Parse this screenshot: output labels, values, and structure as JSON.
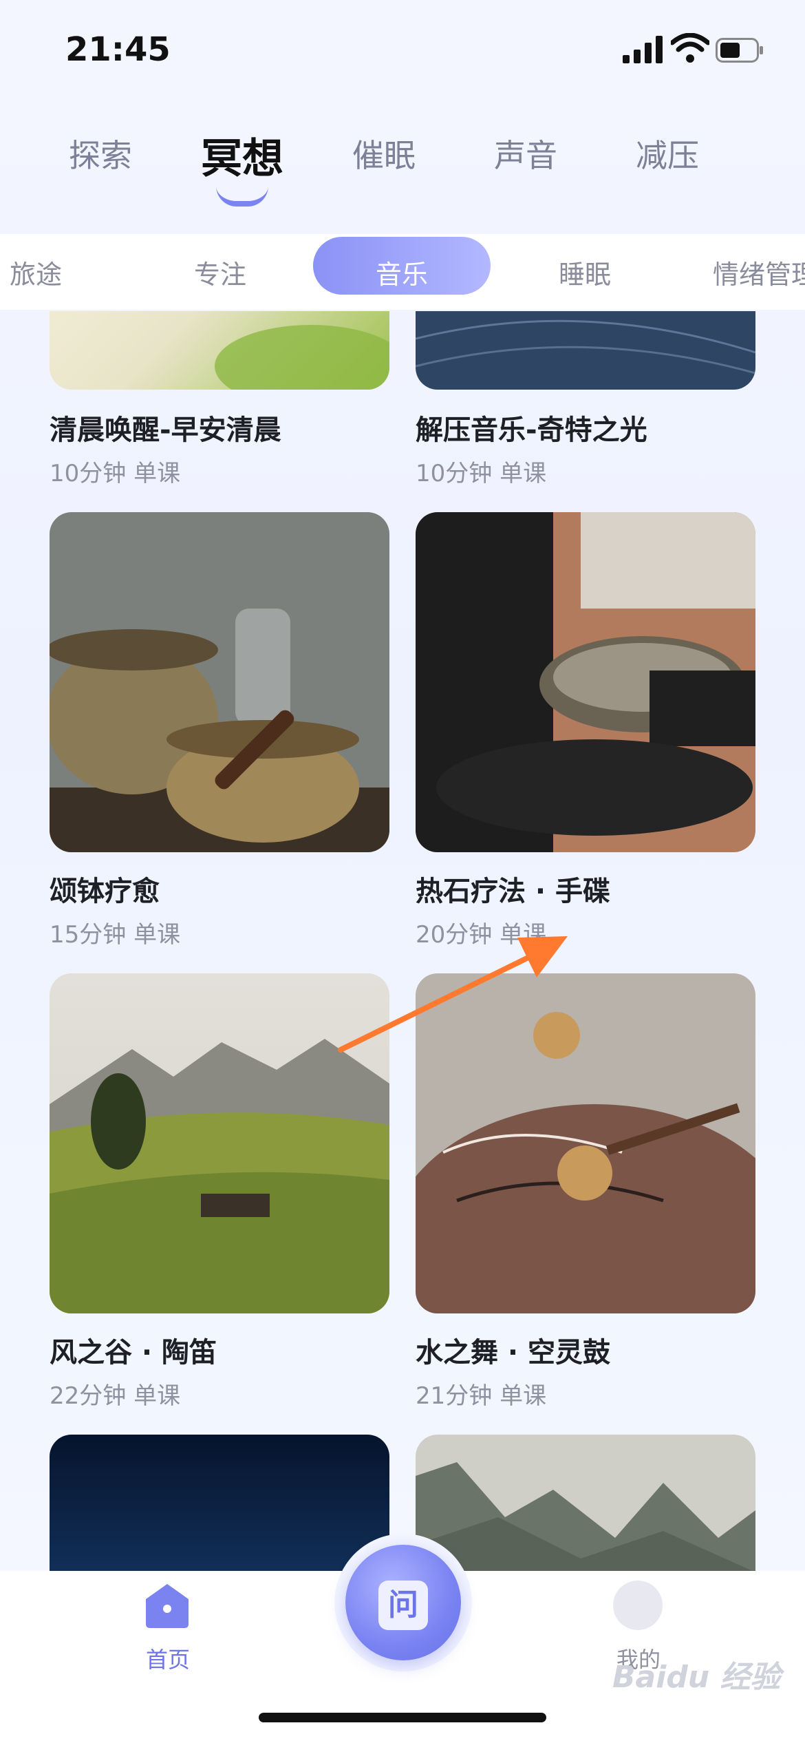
{
  "status_bar": {
    "time": "21:45"
  },
  "top_tabs": [
    {
      "label": "探索",
      "active": false
    },
    {
      "label": "冥想",
      "active": true
    },
    {
      "label": "催眠",
      "active": false
    },
    {
      "label": "声音",
      "active": false
    },
    {
      "label": "减压",
      "active": false
    }
  ],
  "sub_tabs": [
    {
      "label": "旅途",
      "active": false
    },
    {
      "label": "专注",
      "active": false
    },
    {
      "label": "音乐",
      "active": true
    },
    {
      "label": "睡眠",
      "active": false
    },
    {
      "label": "情绪管理",
      "active": false
    }
  ],
  "cards": [
    {
      "title": "清晨唤醒-早安清晨",
      "duration": "10分钟",
      "type": "单课"
    },
    {
      "title": "解压音乐-奇特之光",
      "duration": "10分钟",
      "type": "单课"
    },
    {
      "title": "颂钵疗愈",
      "duration": "15分钟",
      "type": "单课"
    },
    {
      "title": "热石疗法 · 手碟",
      "duration": "20分钟",
      "type": "单课"
    },
    {
      "title": "风之谷 · 陶笛",
      "duration": "22分钟",
      "type": "单课"
    },
    {
      "title": "水之舞 · 空灵鼓",
      "duration": "21分钟",
      "type": "单课"
    },
    {
      "title": "",
      "duration": "",
      "type": ""
    },
    {
      "title": "",
      "duration": "",
      "type": ""
    }
  ],
  "bottom_nav": {
    "home_label": "首页",
    "center_glyph": "问",
    "me_label": "我的"
  },
  "watermark": "Baidu 经验",
  "colors": {
    "accent": "#7b83f0",
    "arrow": "#ff7a2e"
  }
}
